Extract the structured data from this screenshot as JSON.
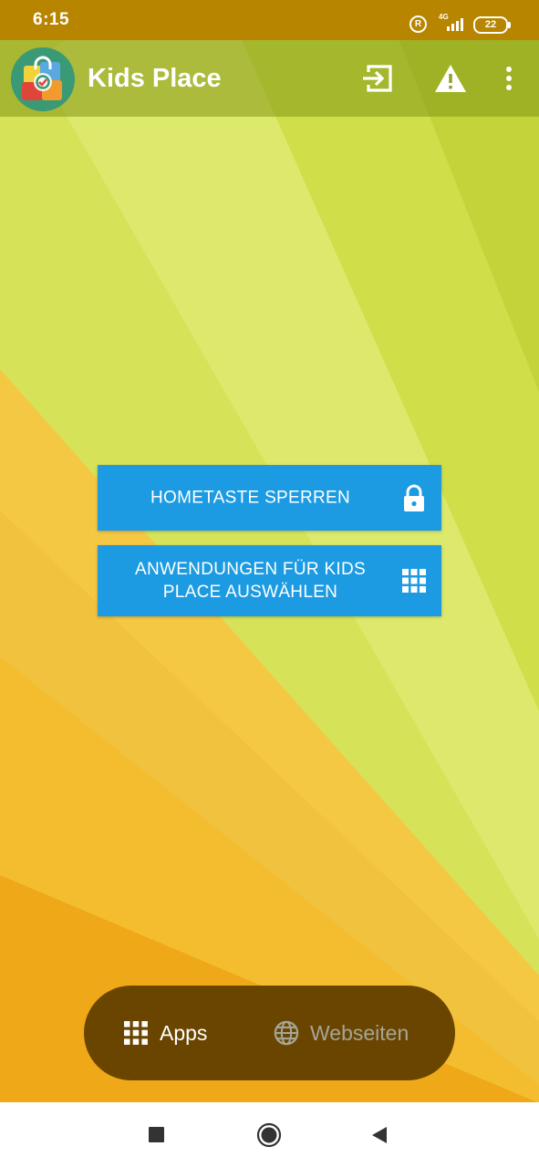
{
  "status_bar": {
    "time": "6:15",
    "registered_badge": "R",
    "network": "4G",
    "battery": "22"
  },
  "app_bar": {
    "title": "Kids Place",
    "icons": [
      "exit-icon",
      "warning-icon",
      "more-vert-icon"
    ]
  },
  "buttons": {
    "lock_home": {
      "label": "HOMETASTE SPERREN",
      "icon": "lock-icon"
    },
    "select_apps": {
      "label": "ANWENDUNGEN FÜR KIDS PLACE AUSWÄHLEN",
      "icon": "grid-icon"
    }
  },
  "switcher": {
    "apps": {
      "label": "Apps",
      "icon": "grid-icon",
      "active": true
    },
    "websites": {
      "label": "Webseiten",
      "icon": "globe-icon",
      "active": false
    }
  },
  "nav_bar": {
    "icons": [
      "recents-square-icon",
      "home-circle-icon",
      "back-triangle-icon"
    ]
  },
  "colors": {
    "status_bar": "#b88500",
    "button_blue": "#1d9be2",
    "switcher_bg": "#6a4500",
    "switcher_active_text": "#ffffff",
    "switcher_inactive_text": "#a5a596"
  }
}
